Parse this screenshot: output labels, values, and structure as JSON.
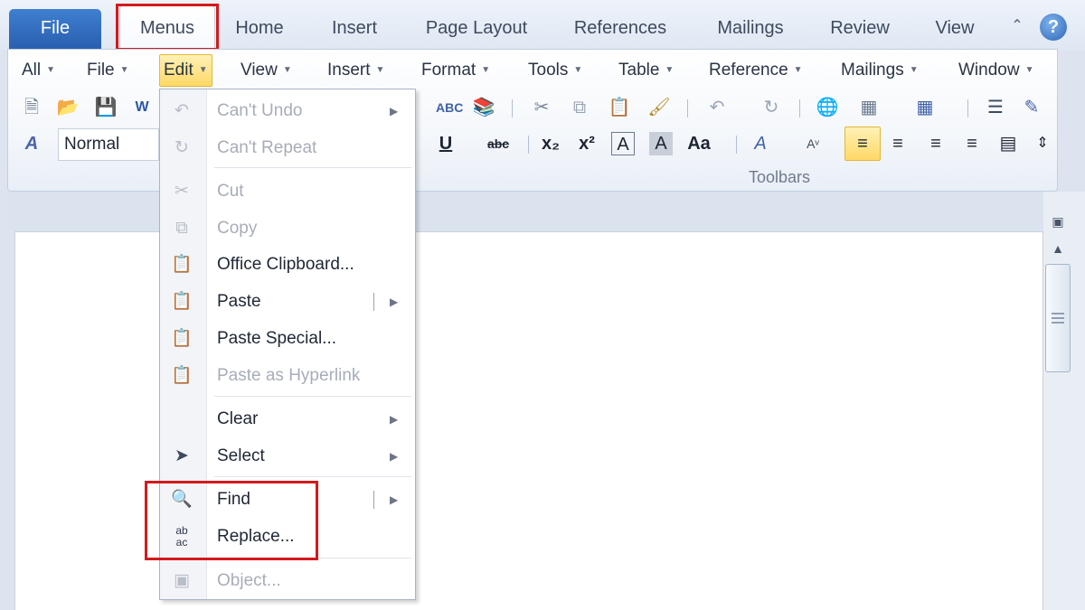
{
  "ribbon_tabs": {
    "file": "File",
    "menus": "Menus",
    "home": "Home",
    "insert": "Insert",
    "page_layout": "Page Layout",
    "references": "References",
    "mailings": "Mailings",
    "review": "Review",
    "view": "View",
    "help": "?"
  },
  "menubar": {
    "all": "All",
    "file": "File",
    "edit": "Edit",
    "view": "View",
    "insert": "Insert",
    "format": "Format",
    "tools": "Tools",
    "table": "Table",
    "reference": "Reference",
    "mailings": "Mailings",
    "window": "Window"
  },
  "toolbar": {
    "style_value": "Normal",
    "group_label": "Toolbars"
  },
  "edit_menu": {
    "undo": "Can't Undo",
    "repeat": "Can't Repeat",
    "cut": "Cut",
    "copy": "Copy",
    "office_clipboard": "Office Clipboard...",
    "paste": "Paste",
    "paste_special": "Paste Special...",
    "paste_hyperlink": "Paste as Hyperlink",
    "clear": "Clear",
    "select": "Select",
    "find": "Find",
    "replace": "Replace...",
    "object": "Object..."
  },
  "colors": {
    "file_tab": "#2f6bbf",
    "highlight_box": "#d4191c",
    "active_menu": "#ffd966"
  }
}
